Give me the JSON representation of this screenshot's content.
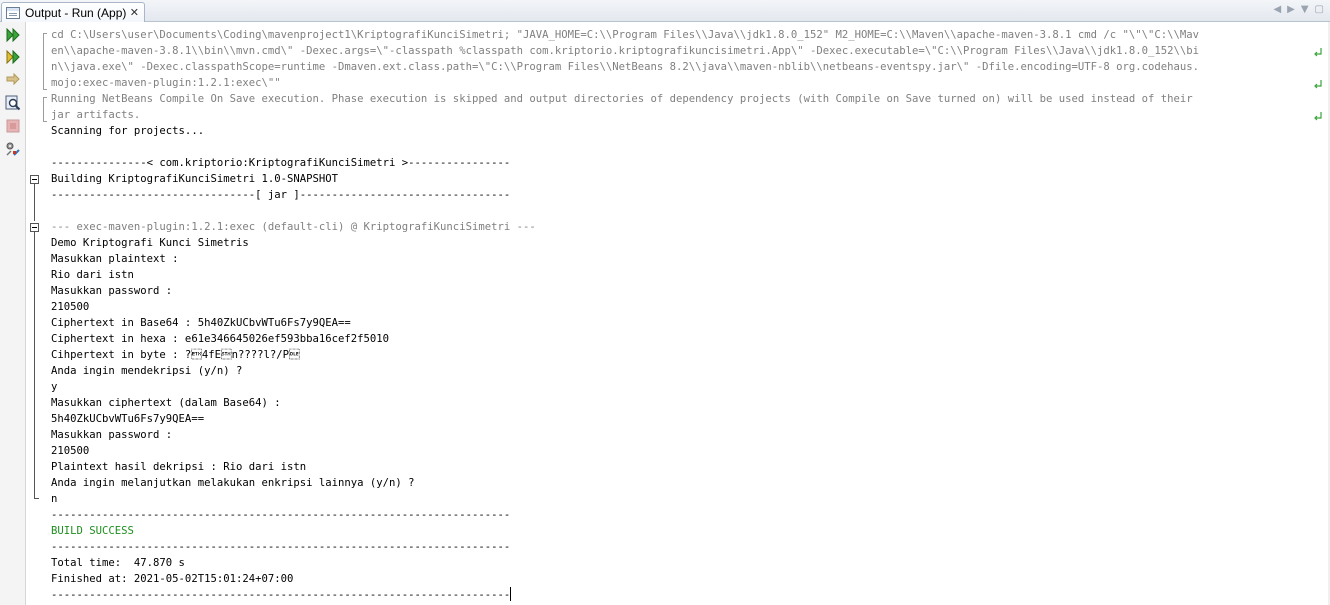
{
  "tab": {
    "title": "Output - Run (App)",
    "close": "✕",
    "icon": "output-window-icon"
  },
  "tab_controls": {
    "prev": "◀",
    "next": "▶",
    "menu": "▼",
    "restore": "▢"
  },
  "toolbar": {
    "rerun": "rerun-icon",
    "rerun_with_options": "rerun-with-options-icon",
    "step": "arrow-right-icon",
    "inspect": "inspect-icon",
    "stop": "stop-icon",
    "settings": "settings-icon"
  },
  "colors": {
    "gray_text": "#808080",
    "success": "#1e8f1e"
  },
  "output": {
    "lines": [
      {
        "text": "cd C:\\Users\\user\\Documents\\Coding\\mavenproject1\\KriptografiKunciSimetri; \"JAVA_HOME=C:\\\\Program Files\\\\Java\\\\jdk1.8.0_152\" M2_HOME=C:\\\\Maven\\\\apache-maven-3.8.1 cmd /c \"\\\"\\\"C:\\\\Mav",
        "style": "gray"
      },
      {
        "text": "en\\\\apache-maven-3.8.1\\\\bin\\\\mvn.cmd\\\" -Dexec.args=\\\"-classpath %classpath com.kriptorio.kriptografikuncisimetri.App\\\" -Dexec.executable=\\\"C:\\\\Program Files\\\\Java\\\\jdk1.8.0_152\\\\bi",
        "style": "gray"
      },
      {
        "text": "n\\\\java.exe\\\" -Dexec.classpathScope=runtime -Dmaven.ext.class.path=\\\"C:\\\\Program Files\\\\NetBeans 8.2\\\\java\\\\maven-nblib\\\\netbeans-eventspy.jar\\\" -Dfile.encoding=UTF-8 org.codehaus.",
        "style": "gray"
      },
      {
        "text": "mojo:exec-maven-plugin:1.2.1:exec\\\"\"",
        "style": "gray"
      },
      {
        "text": "Running NetBeans Compile On Save execution. Phase execution is skipped and output directories of dependency projects (with Compile on Save turned on) will be used instead of their",
        "style": "gray"
      },
      {
        "text": "jar artifacts.",
        "style": "gray"
      },
      {
        "text": "Scanning for projects...",
        "style": "normal"
      },
      {
        "text": "",
        "style": "normal"
      },
      {
        "text": "---------------< com.kriptorio:KriptografiKunciSimetri >----------------",
        "style": "normal"
      },
      {
        "text": "Building KriptografiKunciSimetri 1.0-SNAPSHOT",
        "style": "normal"
      },
      {
        "text": "--------------------------------[ jar ]---------------------------------",
        "style": "normal"
      },
      {
        "text": "",
        "style": "normal"
      },
      {
        "text": "--- exec-maven-plugin:1.2.1:exec (default-cli) @ KriptografiKunciSimetri ---",
        "style": "gray"
      },
      {
        "text": "Demo Kriptografi Kunci Simetris",
        "style": "normal"
      },
      {
        "text": "Masukkan plaintext :",
        "style": "normal"
      },
      {
        "text": "Rio dari istn",
        "style": "normal"
      },
      {
        "text": "Masukkan password :",
        "style": "normal"
      },
      {
        "text": "210500",
        "style": "normal"
      },
      {
        "text": "Ciphertext in Base64 : 5h40ZkUCbvWTu6Fs7y9QEA==",
        "style": "normal"
      },
      {
        "text": "Ciphertext in hexa : e61e346645026ef593bba16cef2f5010",
        "style": "normal"
      },
      {
        "text": "Cihpertext in byte : ?\u00034fE\u0002n????l?/P\u0010",
        "style": "normal"
      },
      {
        "text": "Anda ingin mendekripsi (y/n) ?",
        "style": "normal"
      },
      {
        "text": "y",
        "style": "normal"
      },
      {
        "text": "Masukkan ciphertext (dalam Base64) :",
        "style": "normal"
      },
      {
        "text": "5h40ZkUCbvWTu6Fs7y9QEA==",
        "style": "normal"
      },
      {
        "text": "Masukkan password :",
        "style": "normal"
      },
      {
        "text": "210500",
        "style": "normal"
      },
      {
        "text": "Plaintext hasil dekripsi : Rio dari istn",
        "style": "normal"
      },
      {
        "text": "Anda ingin melanjutkan melakukan enkripsi lainnya (y/n) ?",
        "style": "normal"
      },
      {
        "text": "n",
        "style": "normal"
      },
      {
        "text": "------------------------------------------------------------------------",
        "style": "normal"
      },
      {
        "text": "BUILD SUCCESS",
        "style": "green"
      },
      {
        "text": "------------------------------------------------------------------------",
        "style": "normal"
      },
      {
        "text": "Total time:  47.870 s",
        "style": "normal"
      },
      {
        "text": "Finished at: 2021-05-02T15:01:24+07:00",
        "style": "normal"
      },
      {
        "text": "------------------------------------------------------------------------",
        "style": "normal"
      }
    ]
  }
}
